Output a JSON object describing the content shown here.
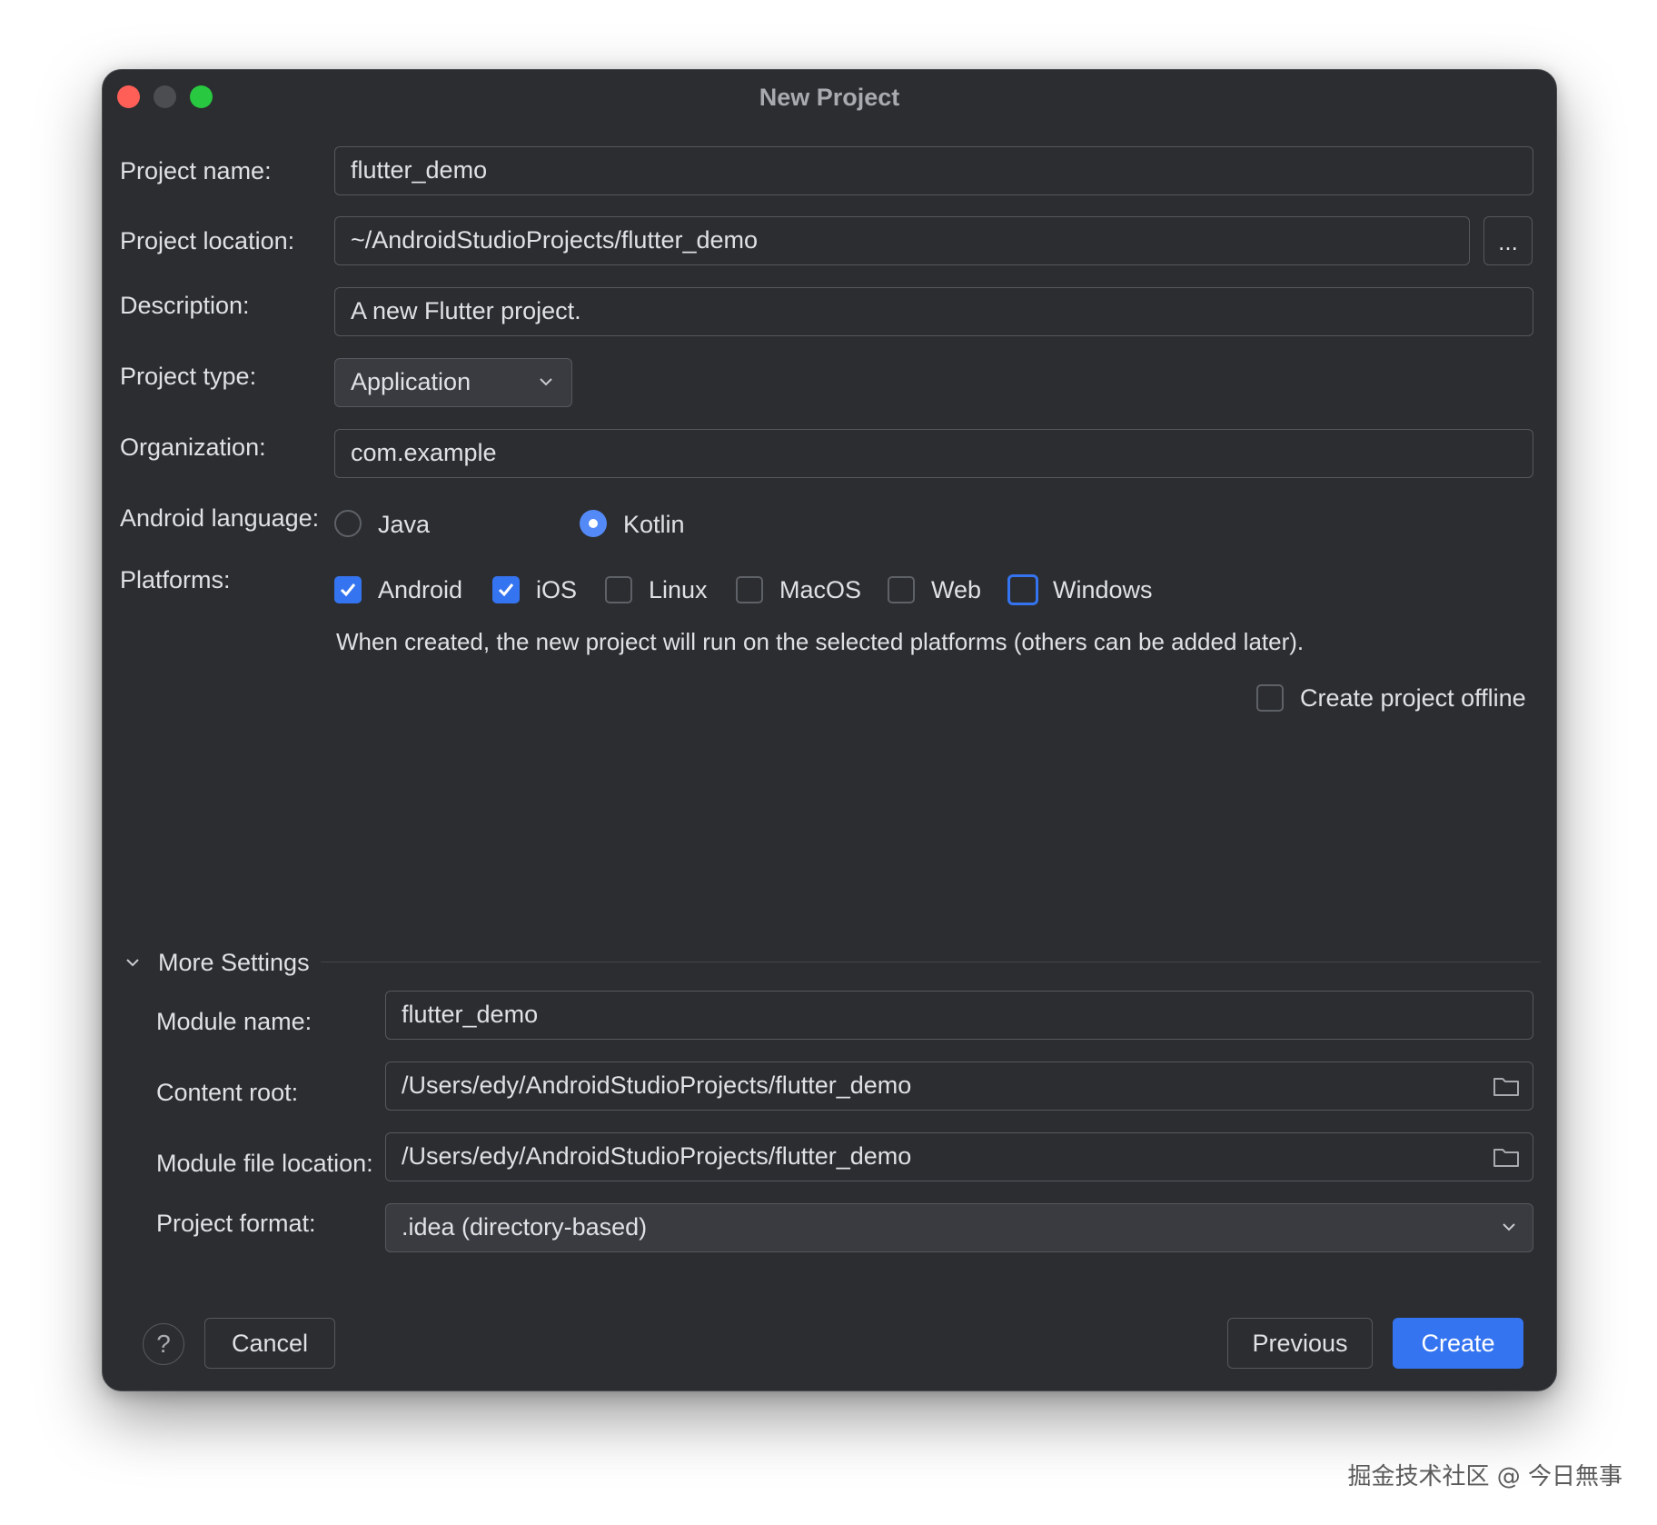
{
  "window": {
    "title": "New Project"
  },
  "form": {
    "project_name": {
      "label": "Project name:",
      "value": "flutter_demo"
    },
    "project_location": {
      "label": "Project location:",
      "value": "~/AndroidStudioProjects/flutter_demo",
      "browse_label": "..."
    },
    "description": {
      "label": "Description:",
      "value": "A new Flutter project."
    },
    "project_type": {
      "label": "Project type:",
      "value": "Application"
    },
    "organization": {
      "label": "Organization:",
      "value": "com.example"
    },
    "android_language": {
      "label": "Android language:",
      "options": [
        {
          "label": "Java",
          "selected": false
        },
        {
          "label": "Kotlin",
          "selected": true
        }
      ]
    },
    "platforms": {
      "label": "Platforms:",
      "items": [
        {
          "label": "Android",
          "checked": true
        },
        {
          "label": "iOS",
          "checked": true
        },
        {
          "label": "Linux",
          "checked": false
        },
        {
          "label": "MacOS",
          "checked": false
        },
        {
          "label": "Web",
          "checked": false
        },
        {
          "label": "Windows",
          "checked": false,
          "focused": true
        }
      ],
      "hint": "When created, the new project will run on the selected platforms (others can be added later)."
    },
    "offline": {
      "label": "Create project offline",
      "checked": false
    }
  },
  "more_settings": {
    "title": "More Settings",
    "expanded": true,
    "module_name": {
      "label": "Module name:",
      "value": "flutter_demo"
    },
    "content_root": {
      "label": "Content root:",
      "value": "/Users/edy/AndroidStudioProjects/flutter_demo"
    },
    "module_file_location": {
      "label": "Module file location:",
      "value": "/Users/edy/AndroidStudioProjects/flutter_demo"
    },
    "project_format": {
      "label": "Project format:",
      "value": ".idea (directory-based)"
    }
  },
  "footer": {
    "help_label": "?",
    "cancel_label": "Cancel",
    "previous_label": "Previous",
    "create_label": "Create"
  },
  "watermark": "掘金技术社区 @ 今日無事",
  "colors": {
    "background": "#2b2d30",
    "accent": "#3574f0",
    "text": "#dfe1e5",
    "border": "#55585d"
  }
}
